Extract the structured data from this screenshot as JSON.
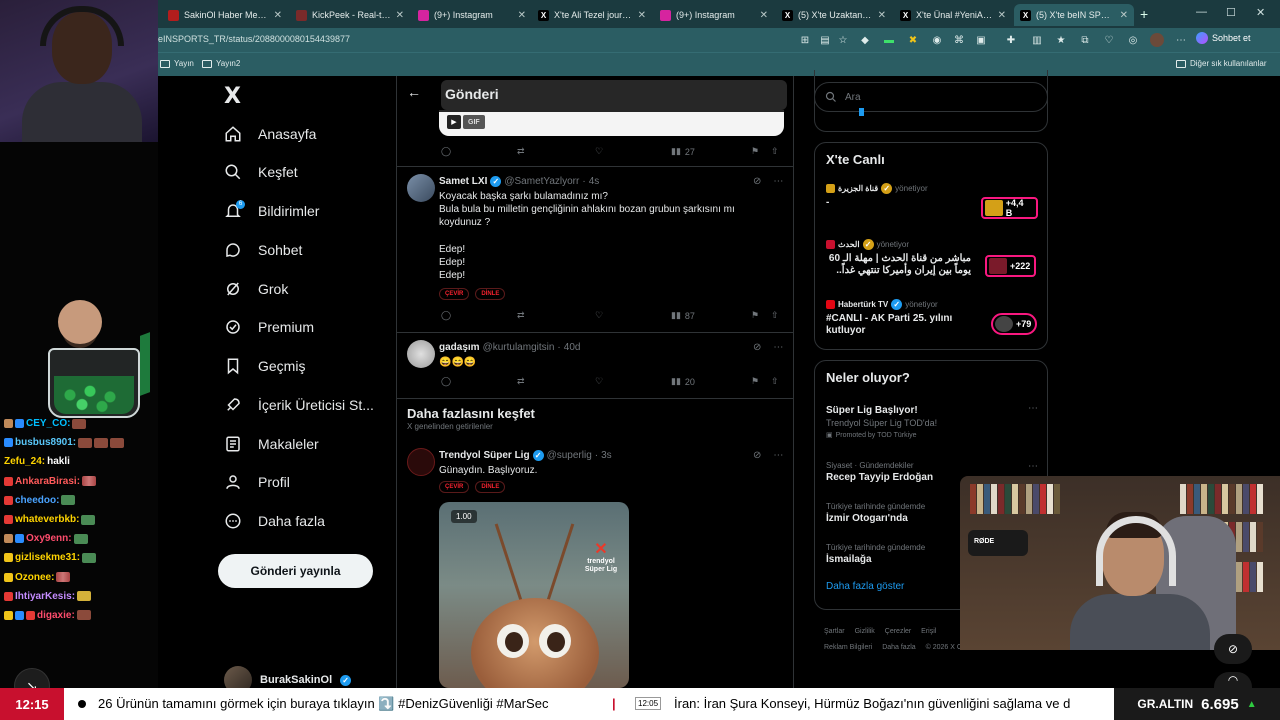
{
  "browser": {
    "tabs": [
      {
        "label": "SakinOl Haber Merkezi",
        "icon": "tv-icon",
        "color": "#b21d1d"
      },
      {
        "label": "KickPeek - Real-time U",
        "icon": "kick-icon",
        "color": "#7a2a2a"
      },
      {
        "label": "(9+) Instagram",
        "icon": "instagram-icon",
        "color": "#d6249f"
      },
      {
        "label": "X'te Ali Tezel journalist",
        "icon": "x-icon",
        "color": "#000000"
      },
      {
        "label": "(9+) Instagram",
        "icon": "instagram-icon",
        "color": "#d6249f"
      },
      {
        "label": "(5) X'te Uzaktan Gelen",
        "icon": "x-icon",
        "color": "#000000"
      },
      {
        "label": "X'te Ünal #YeniAnayas",
        "icon": "x-icon",
        "color": "#000000"
      },
      {
        "label": "(5) X'te beIN SPORTS T",
        "icon": "x-icon",
        "color": "#000000"
      }
    ],
    "url": "eINSPORTS_TR/status/2088000080154439877",
    "chat_button": "Sohbet et",
    "bookmarks": [
      "Yayın",
      "Yayın2"
    ],
    "other_bookmarks": "Diğer sık kullanılanlar"
  },
  "stream_chat": [
    {
      "user": "CEY_CO:",
      "color": "#00bfff",
      "msg": ""
    },
    {
      "user": "busbus8901:",
      "color": "#5ac8fa",
      "msg": ""
    },
    {
      "user": "Zefu_24:",
      "color": "#ffd400",
      "msg": "hakli"
    },
    {
      "user": "AnkaraBirasi:",
      "color": "#ff5a5a",
      "msg": ""
    },
    {
      "user": "cheedoo:",
      "color": "#4aa3ff",
      "msg": ""
    },
    {
      "user": "whateverbkb:",
      "color": "#ffd400",
      "msg": ""
    },
    {
      "user": "Oxy9enn:",
      "color": "#ff4d6d",
      "msg": ""
    },
    {
      "user": "gizlisekme31:",
      "color": "#ffd400",
      "msg": ""
    },
    {
      "user": "Ozonee:",
      "color": "#ffd400",
      "msg": ""
    },
    {
      "user": "IhtiyarKesis:",
      "color": "#c58cff",
      "msg": ""
    },
    {
      "user": "digaxie:",
      "color": "#ff4d6d",
      "msg": ""
    }
  ],
  "nav": {
    "items": [
      {
        "label": "Anasayfa",
        "icon": "home-icon"
      },
      {
        "label": "Keşfet",
        "icon": "search-icon"
      },
      {
        "label": "Bildirimler",
        "icon": "bell-icon"
      },
      {
        "label": "Sohbet",
        "icon": "chat-icon"
      },
      {
        "label": "Grok",
        "icon": "grok-icon"
      },
      {
        "label": "Premium",
        "icon": "premium-icon"
      },
      {
        "label": "Geçmiş",
        "icon": "bookmark-icon"
      },
      {
        "label": "İçerik Üreticisi St...",
        "icon": "rocket-icon"
      },
      {
        "label": "Makaleler",
        "icon": "article-icon"
      },
      {
        "label": "Profil",
        "icon": "profile-icon"
      },
      {
        "label": "Daha fazla",
        "icon": "more-icon"
      }
    ],
    "notification_count": "6",
    "post_button": "Gönderi yayınla",
    "account_name": "BurakSakinOl"
  },
  "timeline": {
    "header_title": "Gönderi",
    "gif_label": "GIF",
    "top_views": "27",
    "tweets": [
      {
        "name": "Samet LXI",
        "handle": "@SametYazlyorr",
        "time": "4s",
        "lines": [
          "Koyacak başka şarkı bulamadınız mı?",
          "Bula bula bu milletin gençliğinin ahlakını bozan grubun şarkısını mı koydunuz ?",
          "",
          "Edep!",
          "Edep!",
          "Edep!"
        ],
        "pills": [
          "ÇEVİR",
          "DİNLE"
        ],
        "views": "87"
      },
      {
        "name": "gadaşım",
        "handle": "@kurtulamgitsin",
        "time": "40d",
        "lines": [
          "😄😄😄"
        ],
        "views": "20"
      }
    ],
    "discover_title": "Daha fazlasını keşfet",
    "discover_sub": "X genelinden getirilenler",
    "sponsored": {
      "name": "Trendyol Süper Lig",
      "handle": "@superlig",
      "time": "3s",
      "text": "Günaydın. Başlıyoruz.",
      "pills": [
        "ÇEVİR",
        "DİNLE"
      ],
      "video_time": "1.00",
      "brand": "trendyol Süper Lig"
    }
  },
  "sidebar": {
    "search_placeholder": "Ara",
    "live_title": "X'te Canlı",
    "live": [
      {
        "source": "قناة الجزيرة",
        "tag": "yönetiyor",
        "text": "-",
        "count": "+4,4 B",
        "logo_color": "#d4a017"
      },
      {
        "source": "الحدث",
        "tag": "yönetiyor",
        "text": "مباشر من قناة الحدث | مهلة الـ 60 يوماً بين إيران وأميركا تنتهي غداً..",
        "count": "+222",
        "logo_color": "#c8102e"
      },
      {
        "source": "Habertürk TV",
        "tag": "yönetiyor",
        "text": "#CANLI - AK Parti 25. yılını kutluyor",
        "count": "+79",
        "logo_color": "#e30613"
      }
    ],
    "trends_title": "Neler oluyor?",
    "trends": [
      {
        "context": "",
        "title": "Süper Lig Başlıyor!",
        "sub": "Trendyol Süper Lig TOD'da!",
        "promo": "Promoted by TOD Türkiye"
      },
      {
        "context": "Siyaset · Gündemdekiler",
        "title": "Recep Tayyip Erdoğan",
        "sub": "",
        "promo": ""
      },
      {
        "context": "Türkiye tarihinde gündemde",
        "title": "İzmir Otogarı'nda",
        "sub": "",
        "promo": ""
      },
      {
        "context": "Türkiye tarihinde gündemde",
        "title": "İsmailağa",
        "sub": "",
        "promo": ""
      }
    ],
    "show_more": "Daha fazla göster",
    "footer": [
      "Şartlar",
      "Gizlilik",
      "Çerezler",
      "Erişil",
      "Reklam Bilgileri",
      "Daha fazla",
      "© 2026 X C"
    ]
  },
  "overlay": {
    "mic_brand": "RØDE"
  },
  "ticker": {
    "clock": "12:15",
    "text1": "26 Ürünün tamamını görmek için buraya tıklayın ⤵️ #DenizGüvenliği #MarSec",
    "time2": "12:05",
    "text2": "İran: İran Şura Konseyi, Hürmüz Boğazı'nın güvenliğini sağlama ve d",
    "gold_label": "GR.ALTIN",
    "gold_value": "6.695"
  }
}
